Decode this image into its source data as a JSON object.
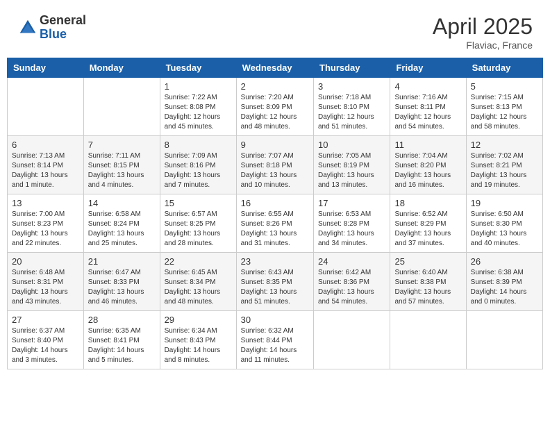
{
  "header": {
    "logo_general": "General",
    "logo_blue": "Blue",
    "title": "April 2025",
    "location": "Flaviac, France"
  },
  "weekdays": [
    "Sunday",
    "Monday",
    "Tuesday",
    "Wednesday",
    "Thursday",
    "Friday",
    "Saturday"
  ],
  "weeks": [
    [
      {
        "day": "",
        "info": ""
      },
      {
        "day": "",
        "info": ""
      },
      {
        "day": "1",
        "info": "Sunrise: 7:22 AM\nSunset: 8:08 PM\nDaylight: 12 hours and 45 minutes."
      },
      {
        "day": "2",
        "info": "Sunrise: 7:20 AM\nSunset: 8:09 PM\nDaylight: 12 hours and 48 minutes."
      },
      {
        "day": "3",
        "info": "Sunrise: 7:18 AM\nSunset: 8:10 PM\nDaylight: 12 hours and 51 minutes."
      },
      {
        "day": "4",
        "info": "Sunrise: 7:16 AM\nSunset: 8:11 PM\nDaylight: 12 hours and 54 minutes."
      },
      {
        "day": "5",
        "info": "Sunrise: 7:15 AM\nSunset: 8:13 PM\nDaylight: 12 hours and 58 minutes."
      }
    ],
    [
      {
        "day": "6",
        "info": "Sunrise: 7:13 AM\nSunset: 8:14 PM\nDaylight: 13 hours and 1 minute."
      },
      {
        "day": "7",
        "info": "Sunrise: 7:11 AM\nSunset: 8:15 PM\nDaylight: 13 hours and 4 minutes."
      },
      {
        "day": "8",
        "info": "Sunrise: 7:09 AM\nSunset: 8:16 PM\nDaylight: 13 hours and 7 minutes."
      },
      {
        "day": "9",
        "info": "Sunrise: 7:07 AM\nSunset: 8:18 PM\nDaylight: 13 hours and 10 minutes."
      },
      {
        "day": "10",
        "info": "Sunrise: 7:05 AM\nSunset: 8:19 PM\nDaylight: 13 hours and 13 minutes."
      },
      {
        "day": "11",
        "info": "Sunrise: 7:04 AM\nSunset: 8:20 PM\nDaylight: 13 hours and 16 minutes."
      },
      {
        "day": "12",
        "info": "Sunrise: 7:02 AM\nSunset: 8:21 PM\nDaylight: 13 hours and 19 minutes."
      }
    ],
    [
      {
        "day": "13",
        "info": "Sunrise: 7:00 AM\nSunset: 8:23 PM\nDaylight: 13 hours and 22 minutes."
      },
      {
        "day": "14",
        "info": "Sunrise: 6:58 AM\nSunset: 8:24 PM\nDaylight: 13 hours and 25 minutes."
      },
      {
        "day": "15",
        "info": "Sunrise: 6:57 AM\nSunset: 8:25 PM\nDaylight: 13 hours and 28 minutes."
      },
      {
        "day": "16",
        "info": "Sunrise: 6:55 AM\nSunset: 8:26 PM\nDaylight: 13 hours and 31 minutes."
      },
      {
        "day": "17",
        "info": "Sunrise: 6:53 AM\nSunset: 8:28 PM\nDaylight: 13 hours and 34 minutes."
      },
      {
        "day": "18",
        "info": "Sunrise: 6:52 AM\nSunset: 8:29 PM\nDaylight: 13 hours and 37 minutes."
      },
      {
        "day": "19",
        "info": "Sunrise: 6:50 AM\nSunset: 8:30 PM\nDaylight: 13 hours and 40 minutes."
      }
    ],
    [
      {
        "day": "20",
        "info": "Sunrise: 6:48 AM\nSunset: 8:31 PM\nDaylight: 13 hours and 43 minutes."
      },
      {
        "day": "21",
        "info": "Sunrise: 6:47 AM\nSunset: 8:33 PM\nDaylight: 13 hours and 46 minutes."
      },
      {
        "day": "22",
        "info": "Sunrise: 6:45 AM\nSunset: 8:34 PM\nDaylight: 13 hours and 48 minutes."
      },
      {
        "day": "23",
        "info": "Sunrise: 6:43 AM\nSunset: 8:35 PM\nDaylight: 13 hours and 51 minutes."
      },
      {
        "day": "24",
        "info": "Sunrise: 6:42 AM\nSunset: 8:36 PM\nDaylight: 13 hours and 54 minutes."
      },
      {
        "day": "25",
        "info": "Sunrise: 6:40 AM\nSunset: 8:38 PM\nDaylight: 13 hours and 57 minutes."
      },
      {
        "day": "26",
        "info": "Sunrise: 6:38 AM\nSunset: 8:39 PM\nDaylight: 14 hours and 0 minutes."
      }
    ],
    [
      {
        "day": "27",
        "info": "Sunrise: 6:37 AM\nSunset: 8:40 PM\nDaylight: 14 hours and 3 minutes."
      },
      {
        "day": "28",
        "info": "Sunrise: 6:35 AM\nSunset: 8:41 PM\nDaylight: 14 hours and 5 minutes."
      },
      {
        "day": "29",
        "info": "Sunrise: 6:34 AM\nSunset: 8:43 PM\nDaylight: 14 hours and 8 minutes."
      },
      {
        "day": "30",
        "info": "Sunrise: 6:32 AM\nSunset: 8:44 PM\nDaylight: 14 hours and 11 minutes."
      },
      {
        "day": "",
        "info": ""
      },
      {
        "day": "",
        "info": ""
      },
      {
        "day": "",
        "info": ""
      }
    ]
  ]
}
